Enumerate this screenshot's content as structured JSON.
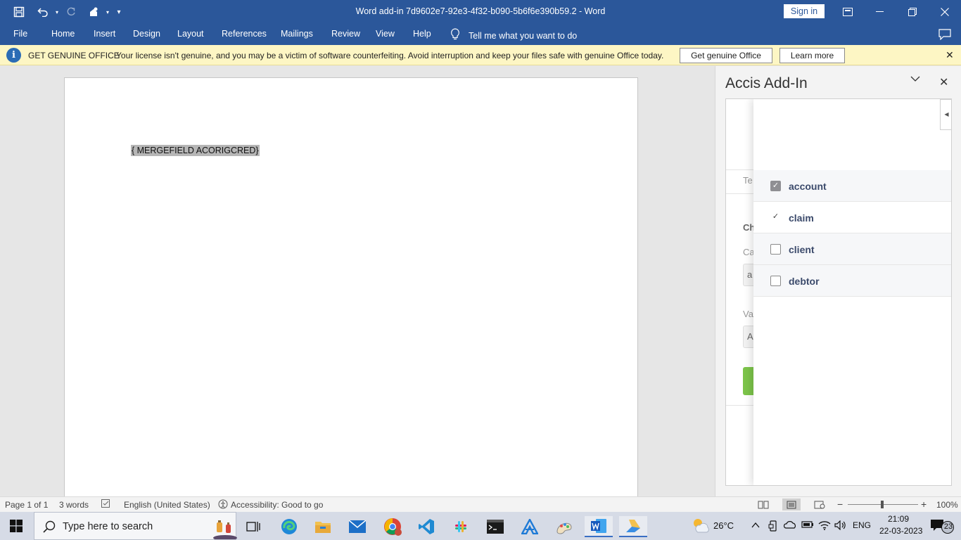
{
  "titlebar": {
    "title": "Word add-in 7d9602e7-92e3-4f32-b090-5b6f6e390b59.2  -  Word",
    "sign_in": "Sign in",
    "accent": "#2b579a"
  },
  "menu": {
    "items": [
      "File",
      "Home",
      "Insert",
      "Design",
      "Layout",
      "References",
      "Mailings",
      "Review",
      "View",
      "Help"
    ],
    "tell_me": "Tell me what you want to do"
  },
  "infobar": {
    "title": "GET GENUINE OFFICE",
    "message": "Your license isn't genuine, and you may be a victim of software counterfeiting. Avoid interruption and keep your files safe with genuine Office today.",
    "get_genuine": "Get genuine Office",
    "learn_more": "Learn more"
  },
  "document": {
    "mergefield": "{ MERGEFIELD ACORIGCRED}"
  },
  "taskpane": {
    "title": "Accis Add-In",
    "behind_labels": [
      "Te",
      "Ch",
      "Ca",
      "a",
      "Va",
      "A"
    ],
    "options": [
      {
        "label": "account",
        "checked": true,
        "style": "filled"
      },
      {
        "label": "claim",
        "checked": true,
        "style": "plain"
      },
      {
        "label": "client",
        "checked": false,
        "style": "empty"
      },
      {
        "label": "debtor",
        "checked": false,
        "style": "empty"
      }
    ],
    "button_color": "#7cc44a"
  },
  "statusbar": {
    "page": "Page 1 of 1",
    "words": "3 words",
    "language": "English (United States)",
    "accessibility": "Accessibility: Good to go",
    "zoom": "100%"
  },
  "taskbar": {
    "search_placeholder": "Type here to search",
    "weather": "26°C",
    "language": "ENG",
    "time": "21:09",
    "date": "22-03-2023",
    "notifications": "23"
  }
}
